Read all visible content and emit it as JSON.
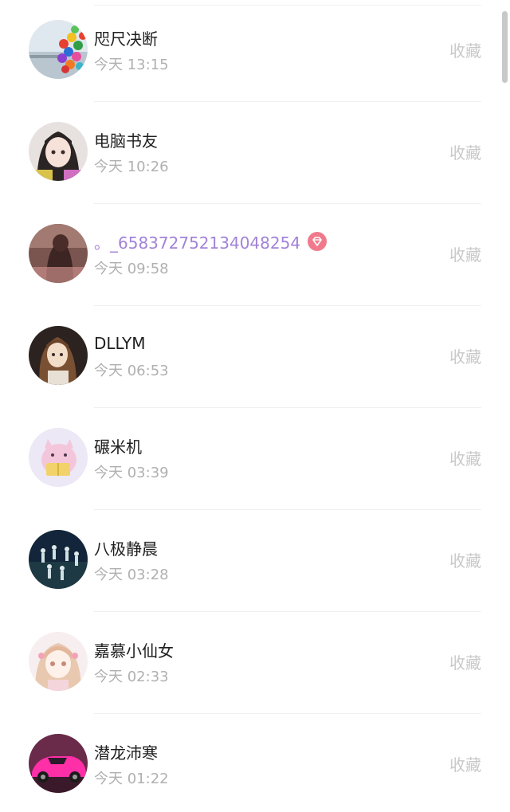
{
  "list": {
    "items": [
      {
        "name": "咫尺决断",
        "time": "今天 13:15",
        "action": "收藏",
        "avatar": "balloons-photo"
      },
      {
        "name": "电脑书友",
        "time": "今天 10:26",
        "action": "收藏",
        "avatar": "anime-girl-photo"
      },
      {
        "name": "。_658372752134048254",
        "time": "今天 09:58",
        "action": "收藏",
        "avatar": "girl-back-photo",
        "vip": true,
        "vip_color": "#f07a8c",
        "name_color": "#a182d8"
      },
      {
        "name": "DLLYM",
        "time": "今天 06:53",
        "action": "收藏",
        "avatar": "ancient-girl-drawing"
      },
      {
        "name": "碾米机",
        "time": "今天 03:39",
        "action": "收藏",
        "avatar": "pink-pig-reading"
      },
      {
        "name": "八极静晨",
        "time": "今天 03:28",
        "action": "收藏",
        "avatar": "dancers-photo"
      },
      {
        "name": "嘉慕小仙女",
        "time": "今天 02:33",
        "action": "收藏",
        "avatar": "pastel-anime-girl"
      },
      {
        "name": "潜龙沛寒",
        "time": "今天 01:22",
        "action": "收藏",
        "avatar": "pink-sports-car"
      }
    ]
  },
  "colors": {
    "name_text": "#1f1f1f",
    "time_text": "#b0b0b0",
    "action_text": "#c9c9c9",
    "divider": "#f0f0f0",
    "scrollbar": "#c8c8c8"
  }
}
